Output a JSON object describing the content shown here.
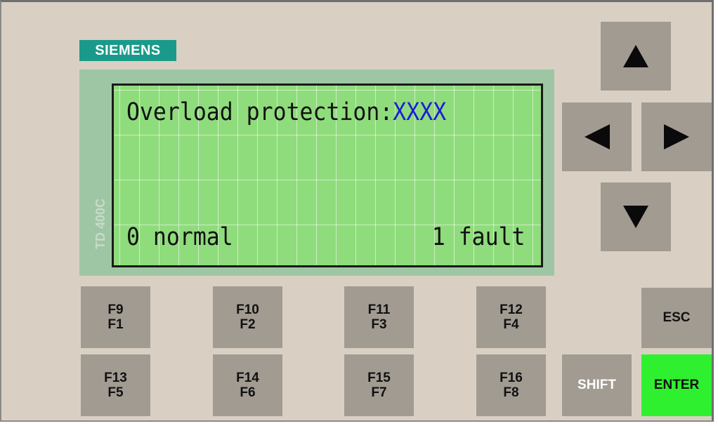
{
  "brand": {
    "name": "SIEMENS",
    "color": "#1a9a8a"
  },
  "device": {
    "model": "TD 400C"
  },
  "display": {
    "line1_label": "Overload protection:",
    "line1_value": "XXXX",
    "line4_left": "0 normal",
    "line4_right": "1 fault",
    "background_color": "#8fdc7c",
    "value_color": "#1c1cd8"
  },
  "nav_keys": {
    "up": "up-arrow-icon",
    "left": "left-arrow-icon",
    "right": "right-arrow-icon",
    "down": "down-arrow-icon"
  },
  "function_keys": [
    {
      "top": "F9",
      "bottom": "F1"
    },
    {
      "top": "F10",
      "bottom": "F2"
    },
    {
      "top": "F11",
      "bottom": "F3"
    },
    {
      "top": "F12",
      "bottom": "F4"
    },
    {
      "top": "F13",
      "bottom": "F5"
    },
    {
      "top": "F14",
      "bottom": "F6"
    },
    {
      "top": "F15",
      "bottom": "F7"
    },
    {
      "top": "F16",
      "bottom": "F8"
    }
  ],
  "control_keys": {
    "esc": "ESC",
    "shift": "SHIFT",
    "enter": "ENTER",
    "enter_color": "#2ef02e"
  }
}
